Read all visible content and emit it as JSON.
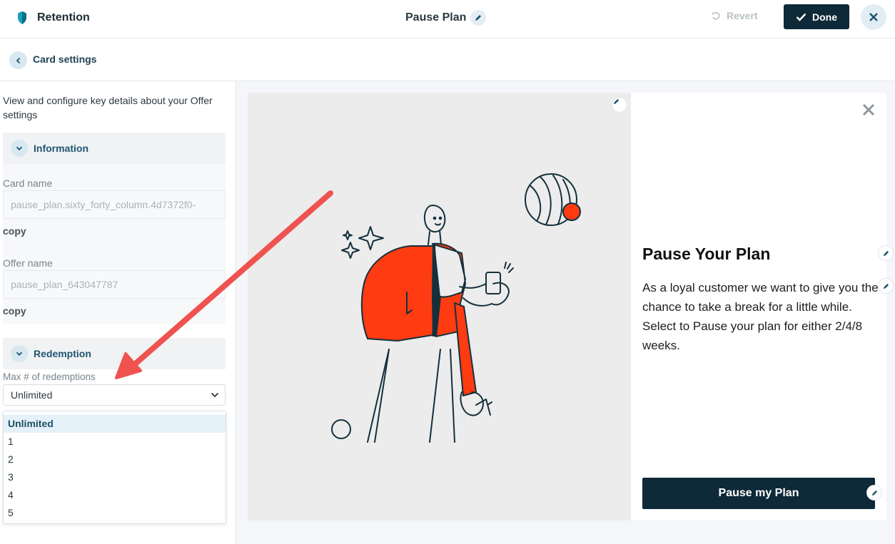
{
  "header": {
    "brand_name": "Retention",
    "title": "Pause Plan",
    "revert_label": "Revert",
    "done_label": "Done"
  },
  "subheader": {
    "title": "Card settings"
  },
  "settings": {
    "description": "View and configure key details about your Offer settings",
    "information": {
      "title": "Information",
      "card_name_label": "Card name",
      "card_name_value": "pause_plan.sixty_forty_column.4d7372f0-",
      "offer_name_label": "Offer name",
      "offer_name_value": "pause_plan_643047787",
      "copy_label": "copy"
    },
    "redemption": {
      "title": "Redemption",
      "max_label": "Max # of redemptions",
      "selected": "Unlimited",
      "options": [
        "Unlimited",
        "1",
        "2",
        "3",
        "4",
        "5"
      ]
    }
  },
  "preview": {
    "heading": "Pause Your Plan",
    "body": "As a loyal customer we want to give you the chance to take a break for a little while. Select to Pause your plan for either 2/4/8 weeks.",
    "cta_label": "Pause my Plan"
  },
  "colors": {
    "primary_dark": "#0e2937",
    "accent_teal": "#1d8fa8",
    "illustration_red": "#ff3b12",
    "annotation_arrow": "#ef5350"
  }
}
